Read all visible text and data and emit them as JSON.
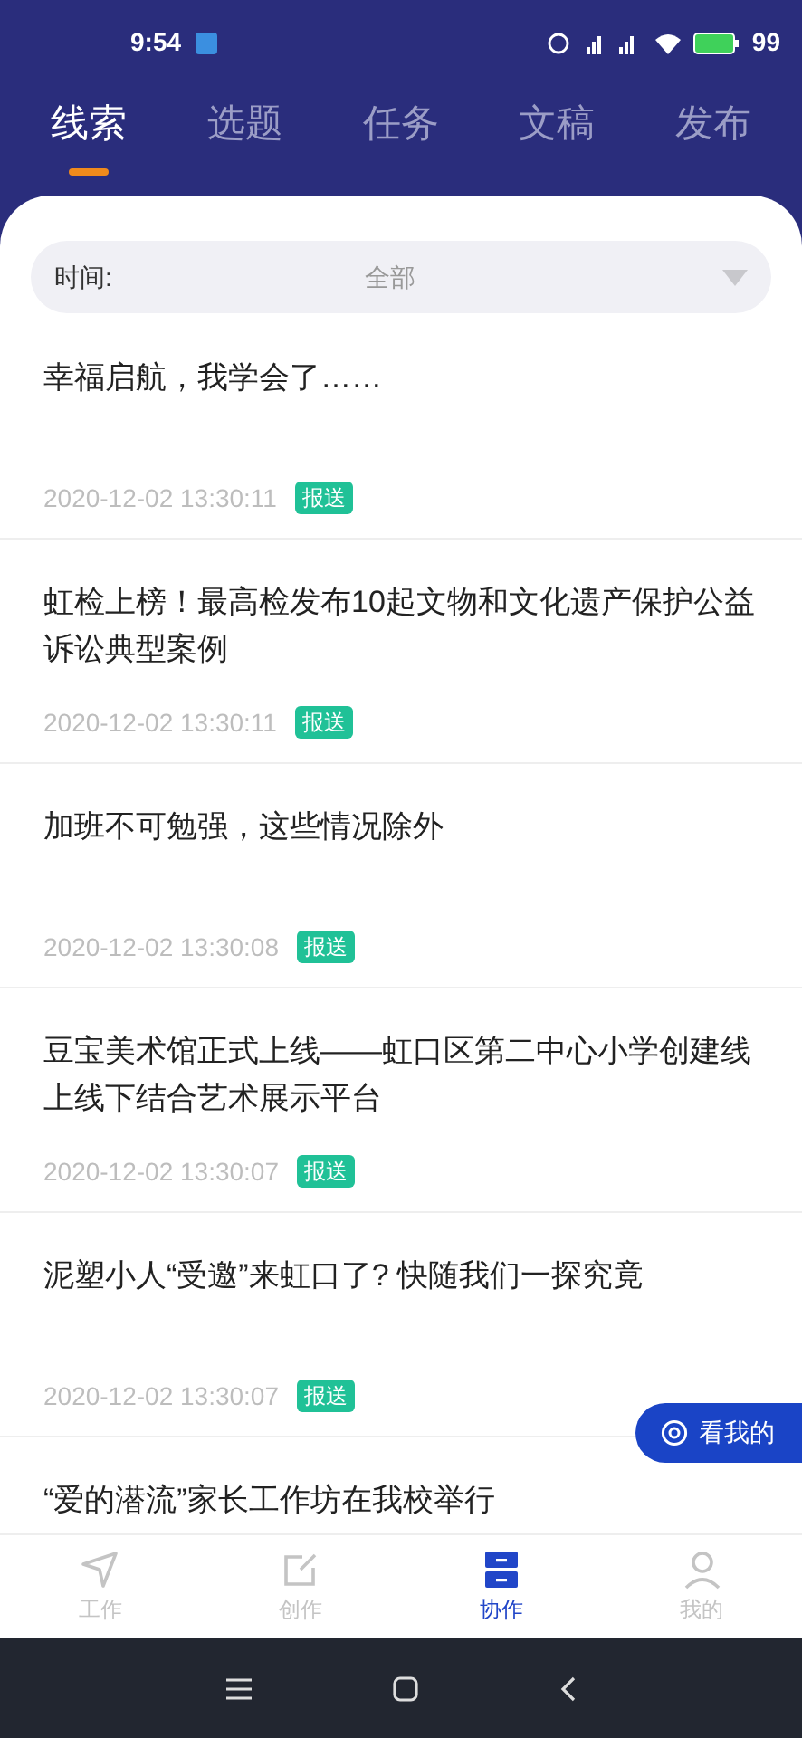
{
  "status_bar": {
    "time": "9:54",
    "battery": "99"
  },
  "tabs": [
    {
      "label": "线索",
      "selected": true
    },
    {
      "label": "选题",
      "selected": false
    },
    {
      "label": "任务",
      "selected": false
    },
    {
      "label": "文稿",
      "selected": false
    },
    {
      "label": "发布",
      "selected": false
    }
  ],
  "filter": {
    "label": "时间:",
    "value": "全部"
  },
  "items": [
    {
      "title": "幸福启航，我学会了……",
      "time": "2020-12-02 13:30:11",
      "tag": "报送"
    },
    {
      "title": "虹检上榜！最高检发布10起文物和文化遗产保护公益诉讼典型案例",
      "time": "2020-12-02 13:30:11",
      "tag": "报送"
    },
    {
      "title": "加班不可勉强，这些情况除外",
      "time": "2020-12-02 13:30:08",
      "tag": "报送"
    },
    {
      "title": "豆宝美术馆正式上线——虹口区第二中心小学创建线上线下结合艺术展示平台",
      "time": "2020-12-02 13:30:07",
      "tag": "报送"
    },
    {
      "title": "泥塑小人“受邀”来虹口了? 快随我们一探究竟",
      "time": "2020-12-02 13:30:07",
      "tag": "报送"
    },
    {
      "title": "“爱的潜流”家长工作坊在我校举行"
    }
  ],
  "float_button": {
    "label": "看我的"
  },
  "bottom_nav": [
    {
      "label": "工作",
      "kind": "send",
      "selected": false
    },
    {
      "label": "创作",
      "kind": "edit",
      "selected": false
    },
    {
      "label": "协作",
      "kind": "drawer",
      "selected": true
    },
    {
      "label": "我的",
      "kind": "person",
      "selected": false
    }
  ]
}
